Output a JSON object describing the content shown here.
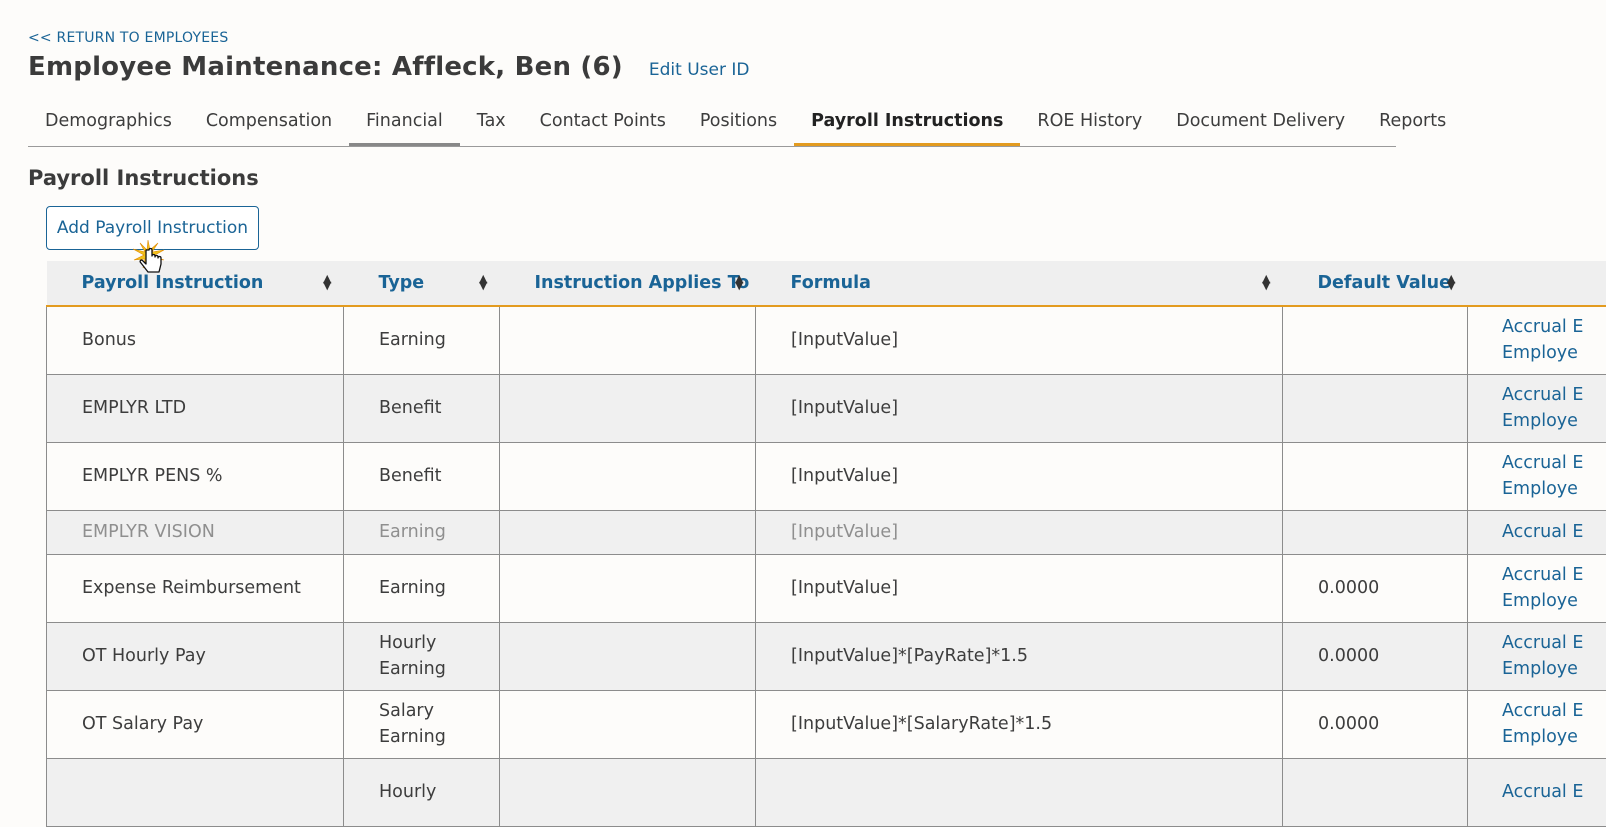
{
  "header": {
    "back_link": "<< RETURN TO EMPLOYEES",
    "title": "Employee Maintenance:  Affleck, Ben (6)",
    "edit_link": "Edit User ID"
  },
  "tabs": [
    {
      "label": "Demographics"
    },
    {
      "label": "Compensation"
    },
    {
      "label": "Financial"
    },
    {
      "label": "Tax"
    },
    {
      "label": "Contact Points"
    },
    {
      "label": "Positions"
    },
    {
      "label": "Payroll Instructions"
    },
    {
      "label": "ROE History"
    },
    {
      "label": "Document Delivery"
    },
    {
      "label": "Reports"
    }
  ],
  "active_tab": "Payroll Instructions",
  "hover_tab": "Financial",
  "section": {
    "title": "Payroll Instructions",
    "add_button": "Add Payroll Instruction"
  },
  "table": {
    "columns": [
      "Payroll Instruction",
      "Type",
      "Instruction Applies To",
      "Formula",
      "Default Value"
    ],
    "rows": [
      {
        "name": "Bonus",
        "type": [
          "Earning"
        ],
        "applies_to": "",
        "formula": "[InputValue]",
        "default": "",
        "links": [
          "Accrual E",
          "Employe"
        ]
      },
      {
        "name": "EMPLYR LTD",
        "type": [
          "Benefit"
        ],
        "applies_to": "",
        "formula": "[InputValue]",
        "default": "",
        "links": [
          "Accrual E",
          "Employe"
        ]
      },
      {
        "name": "EMPLYR PENS %",
        "type": [
          "Benefit"
        ],
        "applies_to": "",
        "formula": "[InputValue]",
        "default": "",
        "links": [
          "Accrual E",
          "Employe"
        ]
      },
      {
        "name": "EMPLYR VISION",
        "type": [
          "Earning"
        ],
        "applies_to": "",
        "formula": "[InputValue]",
        "default": "",
        "links": [
          "Accrual E"
        ]
      },
      {
        "name": "Expense Reimbursement",
        "type": [
          "Earning"
        ],
        "applies_to": "",
        "formula": "[InputValue]",
        "default": "0.0000",
        "links": [
          "Accrual E",
          "Employe"
        ]
      },
      {
        "name": "OT Hourly Pay",
        "type": [
          "Hourly",
          "Earning"
        ],
        "applies_to": "",
        "formula": "[InputValue]*[PayRate]*1.5",
        "default": "0.0000",
        "links": [
          "Accrual E",
          "Employe"
        ]
      },
      {
        "name": "OT Salary Pay",
        "type": [
          "Salary",
          "Earning"
        ],
        "applies_to": "",
        "formula": "[InputValue]*[SalaryRate]*1.5",
        "default": "0.0000",
        "links": [
          "Accrual E",
          "Employe"
        ]
      },
      {
        "name": "",
        "type": [
          "Hourly"
        ],
        "applies_to": "",
        "formula": "",
        "default": "",
        "links": [
          "Accrual E"
        ]
      }
    ]
  },
  "colors": {
    "link": "#1a6496",
    "accent": "#e39b1f",
    "header_bg": "#efefef",
    "row_alt": "#f0f0f0"
  }
}
